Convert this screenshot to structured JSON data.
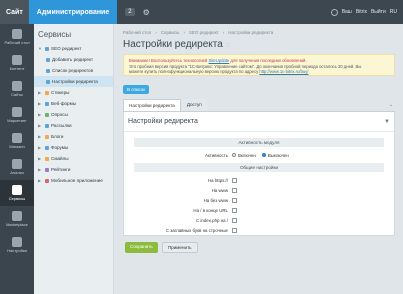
{
  "topbar": {
    "site_label": "Сайт",
    "admin_label": "Администрирование",
    "badge_count": "2",
    "right_items": [
      "Ваш",
      "Bitrix",
      "Выйти",
      "RU"
    ]
  },
  "leftnav": {
    "items": [
      {
        "label": "Рабочий стол",
        "icon": "desktop-icon"
      },
      {
        "label": "Контент",
        "icon": "content-icon"
      },
      {
        "label": "Сайты",
        "icon": "sites-icon"
      },
      {
        "label": "Маркетинг",
        "icon": "marketing-icon"
      },
      {
        "label": "Магазин",
        "icon": "shop-icon"
      },
      {
        "label": "Анализ",
        "icon": "analytics-icon"
      },
      {
        "label": "Сервисы",
        "icon": "services-icon"
      },
      {
        "label": "Marketplace",
        "icon": "marketplace-icon"
      },
      {
        "label": "Настройки",
        "icon": "settings-icon"
      }
    ]
  },
  "sidebar": {
    "title": "Сервисы",
    "items": [
      {
        "label": "SEO редирект",
        "level": 0,
        "expanded": true
      },
      {
        "label": "Добавить редирект",
        "level": 1
      },
      {
        "label": "Список редиректов",
        "level": 1
      },
      {
        "label": "Настройки редиректа",
        "level": 1,
        "active": true
      },
      {
        "label": "Стикеры",
        "level": 0
      },
      {
        "label": "Веб-формы",
        "level": 0
      },
      {
        "label": "Опросы",
        "level": 0
      },
      {
        "label": "Рассылки",
        "level": 0
      },
      {
        "label": "Блоги",
        "level": 0
      },
      {
        "label": "Форумы",
        "level": 0
      },
      {
        "label": "Смайлы",
        "level": 0
      },
      {
        "label": "Рейтинги",
        "level": 0
      },
      {
        "label": "Мобильное приложение",
        "level": 0
      }
    ]
  },
  "breadcrumb": [
    "Рабочий стол",
    "Сервисы",
    "SEO редирект",
    "Настройки редиректа"
  ],
  "page_title": "Настройки редиректа",
  "notice": {
    "line1_warn": "Внимание! Воспользуйтесь технологией",
    "line1_link": "SiteUpdate",
    "line1_rest": "для получения последних обновлений.",
    "line2": "Это пробная версия продукта \"1С-Битрикс: Управление сайтом\". До окончания пробной периода осталось 30 дней. Вы",
    "line3": "можете купить полнофункциональную версию продукта по адресу",
    "line3_link": "http://www.1c-bitrix.ru/buy/"
  },
  "toolbar": {
    "list_button": "В список"
  },
  "tabs": [
    {
      "label": "Настройки редиректа",
      "active": true
    },
    {
      "label": "Доступ",
      "active": false
    }
  ],
  "panel": {
    "title": "Настройки редиректа",
    "section_activity": "Активность модуля",
    "activity_label": "Активность",
    "activity_on": "Включен",
    "activity_off": "Выключен",
    "activity_selected": "off",
    "section_general": "Общие настройки",
    "options": [
      {
        "label": "На https://",
        "checked": false
      },
      {
        "label": "На www",
        "checked": false
      },
      {
        "label": "На без www",
        "checked": false
      },
      {
        "label": "На / в конце URL",
        "checked": false
      },
      {
        "label": "С index.php на /",
        "checked": false
      },
      {
        "label": "С заглавных букв на строчные",
        "checked": false
      }
    ],
    "save_label": "Сохранить",
    "apply_label": "Применить"
  },
  "colors": {
    "accent": "#2f96d9",
    "nav_bg": "#3b454d",
    "save": "#8bbc3e",
    "notice_bg": "#fbf6d4"
  }
}
